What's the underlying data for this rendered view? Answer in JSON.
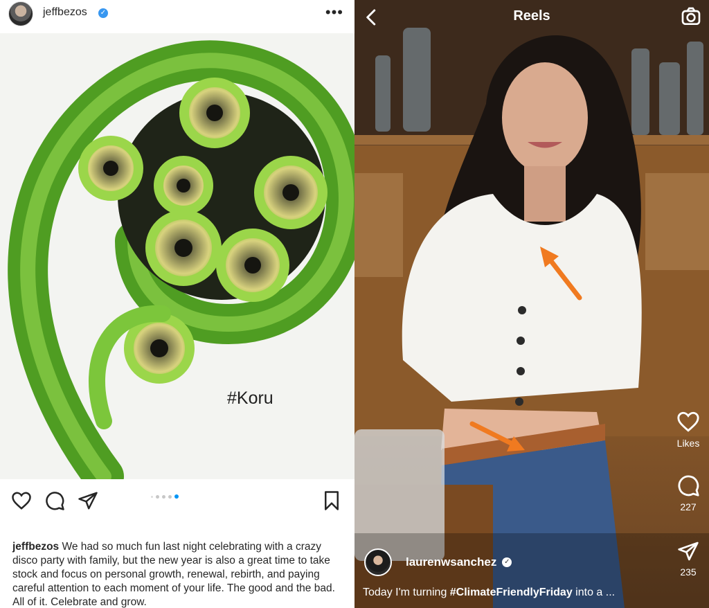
{
  "post": {
    "username": "jeffbezos",
    "verified": true,
    "more_icon": "more-horizontal-icon",
    "image_text": "#Koru",
    "carousel": {
      "count": 5,
      "active_index": 4
    },
    "actions": {
      "like_icon": "heart-icon",
      "comment_icon": "comment-icon",
      "share_icon": "send-icon",
      "save_icon": "bookmark-icon"
    },
    "caption": {
      "username": "jeffbezos",
      "text": "We had so much fun last night celebrating with a crazy disco party with family, but the new year is also a great time to take stock and focus on personal growth, renewal, rebirth, and paying careful attention to each moment of your life. The good and the bad. All of it. Celebrate and grow."
    }
  },
  "reel": {
    "title": "Reels",
    "back_icon": "chevron-left-icon",
    "camera_icon": "camera-icon",
    "likes_label": "Likes",
    "comments_count": "227",
    "shares_count": "235",
    "username": "laurenwsanchez",
    "verified": true,
    "caption_prefix": "Today I'm turning ",
    "caption_tag": "#ClimateFriendlyFriday",
    "caption_suffix": " into a ...",
    "annotation_color": "#f07a20"
  }
}
